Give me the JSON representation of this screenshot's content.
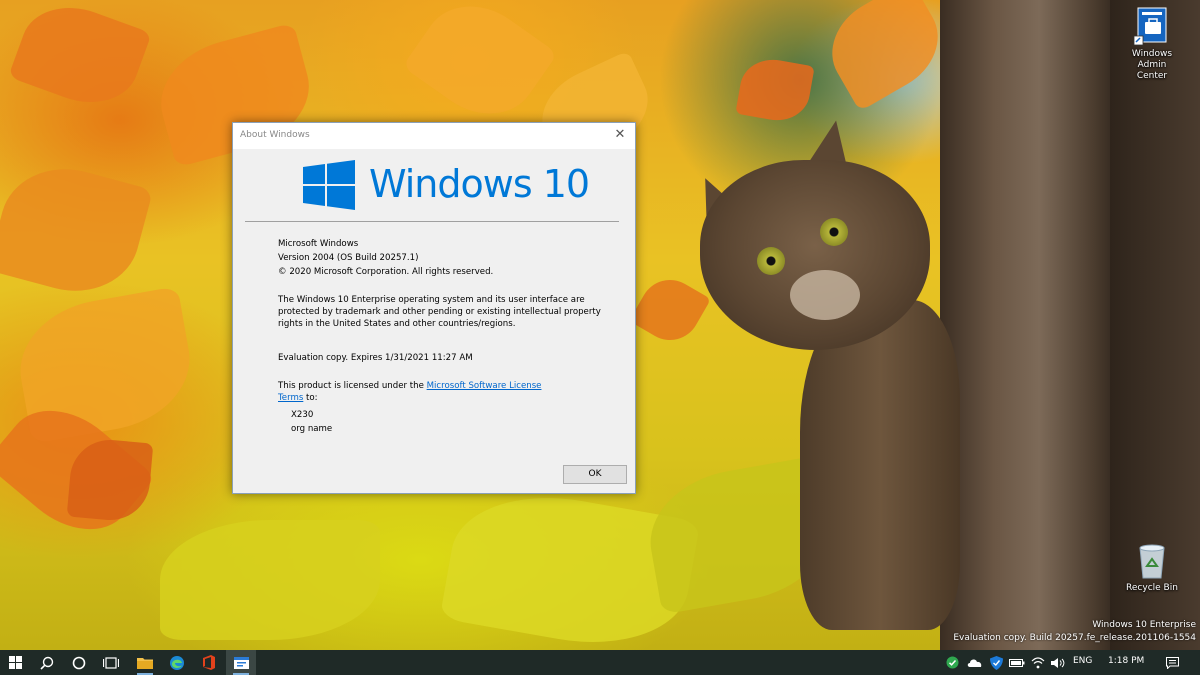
{
  "desktop": {
    "icons": [
      {
        "label": "Windows Admin Center",
        "icon": "windows-admin-center-icon"
      },
      {
        "label": "Recycle Bin",
        "icon": "recycle-bin-icon"
      }
    ],
    "watermark": {
      "edition": "Windows 10 Enterprise",
      "build": "Evaluation copy. Build 20257.fe_release.201106-1554"
    }
  },
  "dialog": {
    "title": "About Windows",
    "close_symbol": "✕",
    "logo_text": "Windows 10",
    "product_name": "Microsoft Windows",
    "version": "Version 2004 (OS Build 20257.1)",
    "copyright": "© 2020 Microsoft Corporation. All rights reserved.",
    "legal_lines": [
      "The Windows 10 Enterprise operating system and its user interface are",
      "protected by trademark and other pending or existing intellectual property",
      "rights in the United States and other countries/regions."
    ],
    "evaluation": "Evaluation copy. Expires 1/31/2021 11:27 AM",
    "license_prefix": "This product is licensed under the ",
    "license_link_1": "Microsoft Software License",
    "license_link_2": "Terms",
    "license_suffix": " to:",
    "licensed_user": "X230",
    "licensed_org": "org name",
    "ok_label": "OK",
    "accent_color": "#0078d7"
  },
  "taskbar": {
    "items": [
      {
        "name": "start-button",
        "icon": "windows-logo-icon"
      },
      {
        "name": "search-button",
        "icon": "search-icon"
      },
      {
        "name": "cortana-button",
        "icon": "cortana-circle-icon"
      },
      {
        "name": "task-view-button",
        "icon": "task-view-icon"
      },
      {
        "name": "file-explorer-button",
        "icon": "folder-icon"
      },
      {
        "name": "edge-button",
        "icon": "edge-icon"
      },
      {
        "name": "office-button",
        "icon": "office-icon"
      },
      {
        "name": "winver-button",
        "icon": "window-app-icon"
      }
    ],
    "tray": {
      "language": "ENG",
      "time": "1:18 PM"
    }
  }
}
